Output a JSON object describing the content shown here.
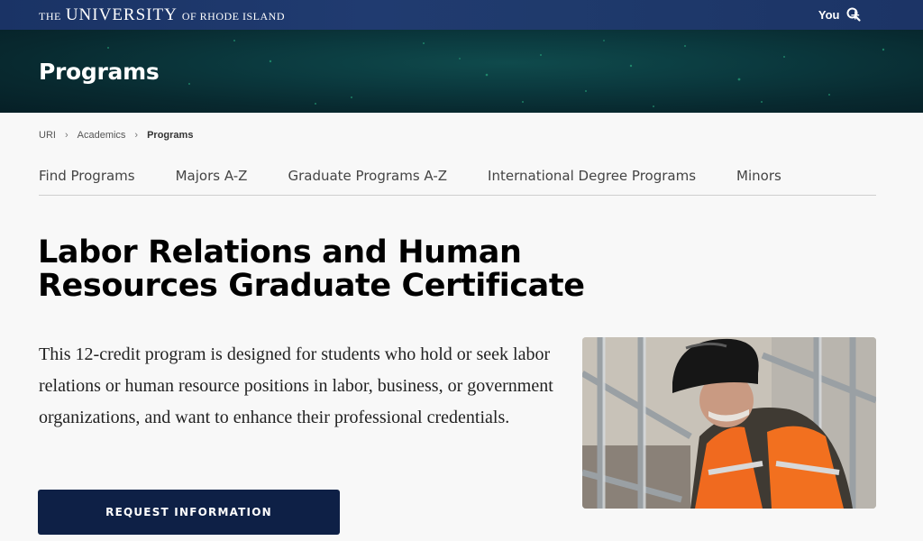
{
  "header": {
    "logo": {
      "the": "THE",
      "university": "UNIVERSITY",
      "of_ri": "OF RHODE ISLAND"
    },
    "you_label": "You",
    "plus_label": "+",
    "search_icon": "search-icon"
  },
  "hero": {
    "title": "Programs"
  },
  "breadcrumb": {
    "items": [
      "URI",
      "Academics",
      "Programs"
    ]
  },
  "subnav": {
    "items": [
      "Find Programs",
      "Majors A-Z",
      "Graduate Programs A-Z",
      "International Degree Programs",
      "Minors"
    ]
  },
  "main": {
    "heading": "Labor Relations and Human Resources Graduate Certificate",
    "description": "This 12-credit program is designed for students who hold or seek labor relations or human resource positions in labor, business, or government organizations, and want to enhance their professional credentials.",
    "cta_label": "REQUEST INFORMATION"
  },
  "colors": {
    "topbar": "#1f3a6c",
    "hero": "#0b3a3f",
    "cta": "#0e2046"
  }
}
